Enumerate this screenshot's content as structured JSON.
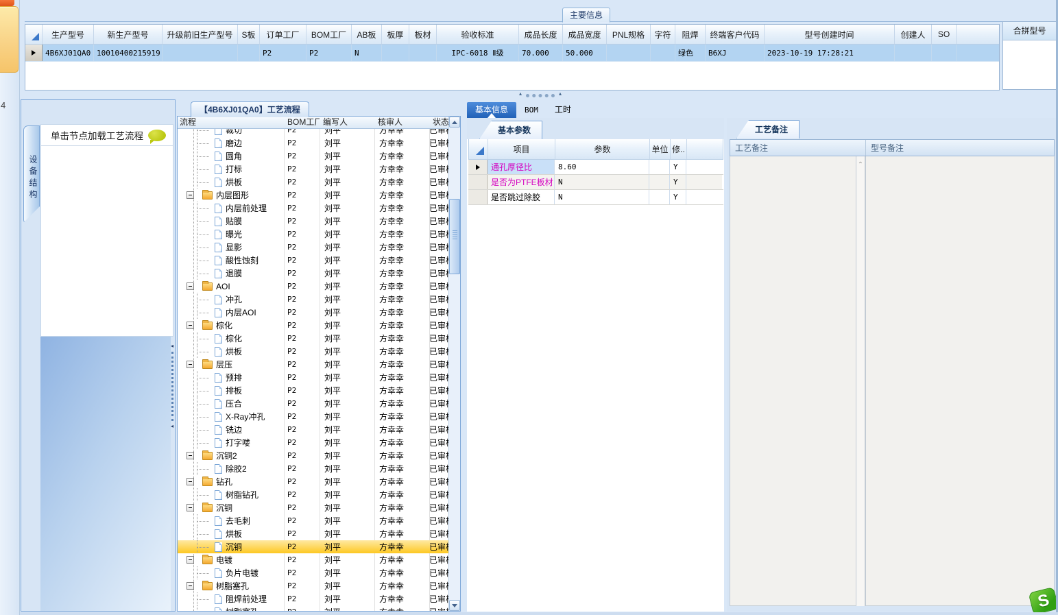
{
  "window": {
    "group_tab": "主要信息",
    "edge_glyph": "4",
    "logo_letter": "S"
  },
  "top_table": {
    "columns": [
      "生产型号",
      "新生产型号",
      "升级前旧生产型号",
      "S板",
      "订单工厂",
      "BOM工厂",
      "AB板",
      "板厚",
      "板材",
      "验收标准",
      "成品长度",
      "成品宽度",
      "PNL规格",
      "字符",
      "阻焊",
      "终端客户代码",
      "型号创建时间",
      "创建人",
      "SO",
      ""
    ],
    "row_values": [
      "4B6XJ01QA0",
      "10010400215919",
      "",
      "",
      "P2",
      "P2",
      "N",
      "",
      "",
      "IPC-6018 Ⅱ级",
      "70.000",
      "50.000",
      "",
      "",
      "绿色",
      "B6XJ",
      "2023-10-19 17:28:21",
      "",
      "",
      ""
    ]
  },
  "merge_panel": {
    "title": "合拼型号"
  },
  "device_panel": {
    "vertical_tab": "设备结构",
    "hint": "单击节点加载工艺流程"
  },
  "flow_panel": {
    "title": "【4B6XJ01QA0】工艺流程",
    "columns": [
      "流程",
      "BOM工厂",
      "编写人",
      "核审人",
      "状态"
    ],
    "row_defaults": {
      "bom_factory": "P2",
      "writer": "刘平",
      "reviewer": "方幸幸",
      "status": "已审核"
    },
    "rows": [
      {
        "label": "裁切",
        "kind": "doc"
      },
      {
        "label": "磨边",
        "kind": "doc"
      },
      {
        "label": "圆角",
        "kind": "doc"
      },
      {
        "label": "打标",
        "kind": "doc"
      },
      {
        "label": "烘板",
        "kind": "doc"
      },
      {
        "label": "内层图形",
        "kind": "folder"
      },
      {
        "label": "内层前处理",
        "kind": "doc"
      },
      {
        "label": "贴膜",
        "kind": "doc"
      },
      {
        "label": "曝光",
        "kind": "doc"
      },
      {
        "label": "显影",
        "kind": "doc"
      },
      {
        "label": "酸性蚀刻",
        "kind": "doc"
      },
      {
        "label": "退膜",
        "kind": "doc"
      },
      {
        "label": "AOI",
        "kind": "folder"
      },
      {
        "label": "冲孔",
        "kind": "doc"
      },
      {
        "label": "内层AOI",
        "kind": "doc"
      },
      {
        "label": "棕化",
        "kind": "folder"
      },
      {
        "label": "棕化",
        "kind": "doc"
      },
      {
        "label": "烘板",
        "kind": "doc"
      },
      {
        "label": "层压",
        "kind": "folder"
      },
      {
        "label": "预排",
        "kind": "doc"
      },
      {
        "label": "排板",
        "kind": "doc"
      },
      {
        "label": "压合",
        "kind": "doc"
      },
      {
        "label": "X-Ray冲孔",
        "kind": "doc"
      },
      {
        "label": "铣边",
        "kind": "doc"
      },
      {
        "label": "打字喽",
        "kind": "doc"
      },
      {
        "label": "沉铜2",
        "kind": "folder"
      },
      {
        "label": "除胶2",
        "kind": "doc"
      },
      {
        "label": "钻孔",
        "kind": "folder"
      },
      {
        "label": "树脂钻孔",
        "kind": "doc"
      },
      {
        "label": "沉铜",
        "kind": "folder"
      },
      {
        "label": "去毛刺",
        "kind": "doc"
      },
      {
        "label": "烘板",
        "kind": "doc"
      },
      {
        "label": "沉铜",
        "kind": "doc",
        "selected": true
      },
      {
        "label": "电镀",
        "kind": "folder"
      },
      {
        "label": "负片电镀",
        "kind": "doc"
      },
      {
        "label": "树脂塞孔",
        "kind": "folder"
      },
      {
        "label": "阻焊前处理",
        "kind": "doc"
      },
      {
        "label": "树脂塞孔",
        "kind": "doc"
      }
    ]
  },
  "detail_panel": {
    "tabs": [
      {
        "label": "基本信息",
        "active": true
      },
      {
        "label": "BOM",
        "active": false
      },
      {
        "label": "工时",
        "active": false
      }
    ],
    "params_tab": "基本参数",
    "params_columns": [
      "项目",
      "参数",
      "单位",
      "修.."
    ],
    "params_rows": [
      {
        "item": "通孔厚径比",
        "value": "8.60",
        "unit": "",
        "modifiable": "Y",
        "item_color": "magenta",
        "selected": true
      },
      {
        "item": "是否为PTFE板材",
        "value": "N",
        "unit": "",
        "modifiable": "Y",
        "item_color": "magenta",
        "selected": false
      },
      {
        "item": "是否跳过除胶",
        "value": "N",
        "unit": "",
        "modifiable": "Y",
        "item_color": "black",
        "selected": false
      }
    ]
  },
  "notes_panel": {
    "tab": "工艺备注",
    "columns": [
      "工艺备注",
      "型号备注"
    ],
    "process_note": "",
    "model_note": ""
  },
  "colors": {
    "accent_blue": "#2f6fc4",
    "selected_row_blue": "#b3d4f2",
    "tree_selected_orange": "#fdc822",
    "param_magenta": "#d400c0",
    "logo_green": "#3faa1f",
    "bubble_yellow_green": "#c2cf1d"
  }
}
